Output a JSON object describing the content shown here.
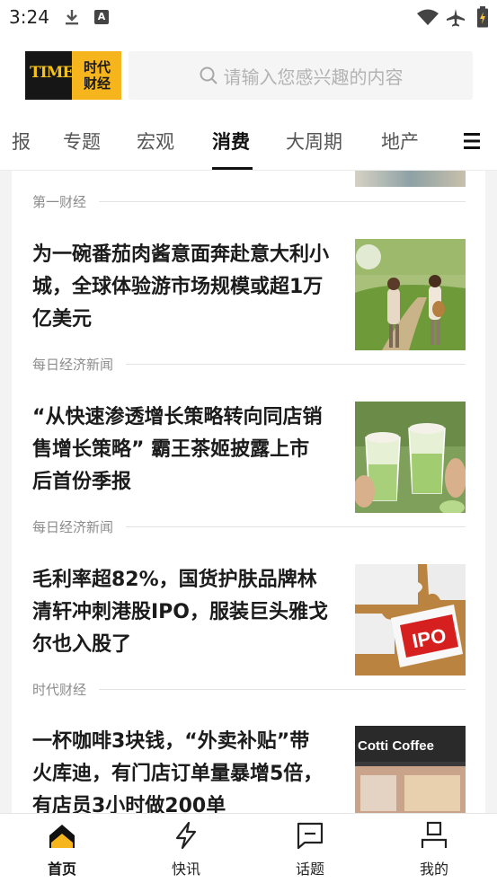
{
  "status_bar": {
    "time": "3:24",
    "icons": [
      "download-icon",
      "a-icon",
      "wifi-icon",
      "airplane-icon",
      "battery-icon"
    ],
    "a_icon_letter": "A"
  },
  "header": {
    "logo_en": "TIME",
    "logo_cn_line1": "时代",
    "logo_cn_line2": "财经",
    "search_placeholder": "请输入您感兴趣的内容"
  },
  "tabs": {
    "items": [
      {
        "label": "报",
        "active": false
      },
      {
        "label": "专题",
        "active": false
      },
      {
        "label": "宏观",
        "active": false
      },
      {
        "label": "消费",
        "active": true
      },
      {
        "label": "大周期",
        "active": false
      },
      {
        "label": "地产",
        "active": false
      }
    ]
  },
  "feed": {
    "sources": [
      {
        "name": "第一财经"
      },
      {
        "name": "每日经济新闻"
      },
      {
        "name": "每日经济新闻"
      },
      {
        "name": "时代财经"
      }
    ],
    "articles": [
      {
        "title": "为一碗番茄肉酱意面奔赴意大利小城，全球体验游市场规模或超1万亿美元"
      },
      {
        "title": "“从快速渗透增长策略转向同店销售增长策略” 霸王茶姬披露上市后首份季报"
      },
      {
        "title": "毛利率超82%，国货护肤品牌林清轩冲刺港股IPO，服装巨头雅戈尔也入股了"
      },
      {
        "title": "一杯咖啡3块钱，“外卖补贴”带火库迪，有门店订单量暴增5倍，有店员3小时做200单"
      }
    ],
    "ipo_tag": "IPO",
    "cotti_sign": "Cotti Coffee"
  },
  "bottom_nav": {
    "items": [
      {
        "label": "首页",
        "icon": "home-icon",
        "active": true
      },
      {
        "label": "快讯",
        "icon": "lightning-icon",
        "active": false
      },
      {
        "label": "话题",
        "icon": "topic-icon",
        "active": false
      },
      {
        "label": "我的",
        "icon": "profile-icon",
        "active": false
      }
    ]
  },
  "colors": {
    "brand_gold": "#f6b51c",
    "brand_dark": "#161616",
    "ipo_red": "#d61f1f"
  }
}
